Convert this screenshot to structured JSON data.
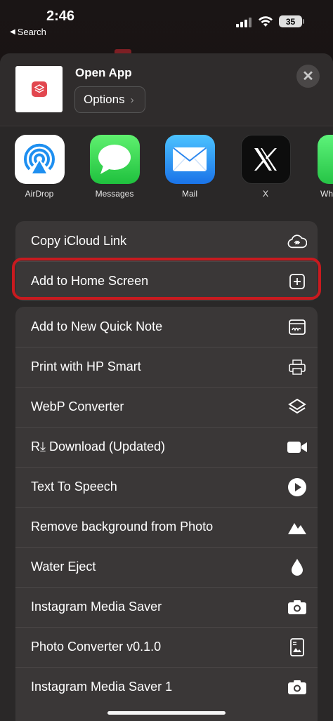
{
  "status": {
    "time": "2:46",
    "back_label": "Search",
    "battery": "35"
  },
  "header": {
    "title": "Open App",
    "options_label": "Options",
    "options_chevron": "›",
    "close_glyph": "✕"
  },
  "apps": [
    {
      "label": "AirDrop",
      "icon": "airdrop-icon"
    },
    {
      "label": "Messages",
      "icon": "messages-icon"
    },
    {
      "label": "Mail",
      "icon": "mail-icon"
    },
    {
      "label": "X",
      "icon": "x-logo-icon"
    },
    {
      "label": "Wh",
      "icon": "whatsapp-icon"
    }
  ],
  "group1": [
    {
      "label": "Copy iCloud Link",
      "icon": "cloud-link-icon"
    },
    {
      "label": "Add to Home Screen",
      "icon": "plus-square-icon"
    }
  ],
  "group2": [
    {
      "label": "Add to New Quick Note",
      "icon": "quick-note-icon"
    },
    {
      "label": "Print with HP Smart",
      "icon": "printer-icon"
    },
    {
      "label": "WebP Converter",
      "icon": "layers-icon"
    },
    {
      "label": "R⤓ Download (Updated)",
      "icon": "video-camera-icon"
    },
    {
      "label": "Text To Speech",
      "icon": "play-circle-icon"
    },
    {
      "label": "Remove background from Photo",
      "icon": "mountain-icon"
    },
    {
      "label": "Water Eject",
      "icon": "water-drop-icon"
    },
    {
      "label": "Instagram Media Saver",
      "icon": "camera-icon"
    },
    {
      "label": "Photo Converter v0.1.0",
      "icon": "photo-document-icon"
    },
    {
      "label": "Instagram Media Saver 1",
      "icon": "camera-icon"
    }
  ],
  "colors": {
    "highlight": "#c81a1f",
    "sheet": "#2a2828",
    "row_bg": "#3a3737"
  }
}
